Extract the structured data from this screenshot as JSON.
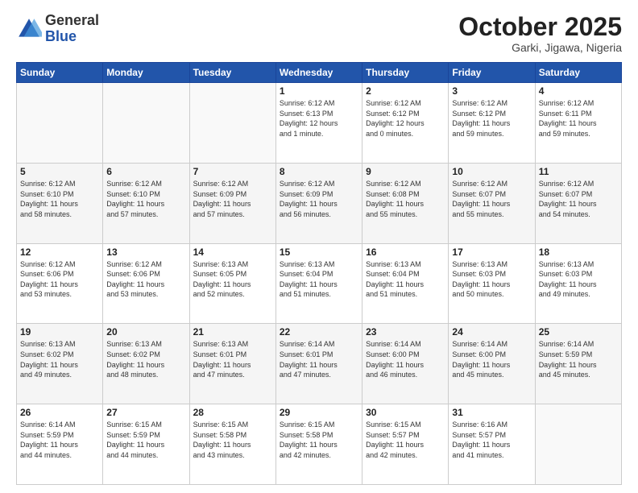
{
  "logo": {
    "general": "General",
    "blue": "Blue"
  },
  "header": {
    "month": "October 2025",
    "location": "Garki, Jigawa, Nigeria"
  },
  "weekdays": [
    "Sunday",
    "Monday",
    "Tuesday",
    "Wednesday",
    "Thursday",
    "Friday",
    "Saturday"
  ],
  "weeks": [
    [
      {
        "day": "",
        "info": ""
      },
      {
        "day": "",
        "info": ""
      },
      {
        "day": "",
        "info": ""
      },
      {
        "day": "1",
        "info": "Sunrise: 6:12 AM\nSunset: 6:13 PM\nDaylight: 12 hours\nand 1 minute."
      },
      {
        "day": "2",
        "info": "Sunrise: 6:12 AM\nSunset: 6:12 PM\nDaylight: 12 hours\nand 0 minutes."
      },
      {
        "day": "3",
        "info": "Sunrise: 6:12 AM\nSunset: 6:12 PM\nDaylight: 11 hours\nand 59 minutes."
      },
      {
        "day": "4",
        "info": "Sunrise: 6:12 AM\nSunset: 6:11 PM\nDaylight: 11 hours\nand 59 minutes."
      }
    ],
    [
      {
        "day": "5",
        "info": "Sunrise: 6:12 AM\nSunset: 6:10 PM\nDaylight: 11 hours\nand 58 minutes."
      },
      {
        "day": "6",
        "info": "Sunrise: 6:12 AM\nSunset: 6:10 PM\nDaylight: 11 hours\nand 57 minutes."
      },
      {
        "day": "7",
        "info": "Sunrise: 6:12 AM\nSunset: 6:09 PM\nDaylight: 11 hours\nand 57 minutes."
      },
      {
        "day": "8",
        "info": "Sunrise: 6:12 AM\nSunset: 6:09 PM\nDaylight: 11 hours\nand 56 minutes."
      },
      {
        "day": "9",
        "info": "Sunrise: 6:12 AM\nSunset: 6:08 PM\nDaylight: 11 hours\nand 55 minutes."
      },
      {
        "day": "10",
        "info": "Sunrise: 6:12 AM\nSunset: 6:07 PM\nDaylight: 11 hours\nand 55 minutes."
      },
      {
        "day": "11",
        "info": "Sunrise: 6:12 AM\nSunset: 6:07 PM\nDaylight: 11 hours\nand 54 minutes."
      }
    ],
    [
      {
        "day": "12",
        "info": "Sunrise: 6:12 AM\nSunset: 6:06 PM\nDaylight: 11 hours\nand 53 minutes."
      },
      {
        "day": "13",
        "info": "Sunrise: 6:12 AM\nSunset: 6:06 PM\nDaylight: 11 hours\nand 53 minutes."
      },
      {
        "day": "14",
        "info": "Sunrise: 6:13 AM\nSunset: 6:05 PM\nDaylight: 11 hours\nand 52 minutes."
      },
      {
        "day": "15",
        "info": "Sunrise: 6:13 AM\nSunset: 6:04 PM\nDaylight: 11 hours\nand 51 minutes."
      },
      {
        "day": "16",
        "info": "Sunrise: 6:13 AM\nSunset: 6:04 PM\nDaylight: 11 hours\nand 51 minutes."
      },
      {
        "day": "17",
        "info": "Sunrise: 6:13 AM\nSunset: 6:03 PM\nDaylight: 11 hours\nand 50 minutes."
      },
      {
        "day": "18",
        "info": "Sunrise: 6:13 AM\nSunset: 6:03 PM\nDaylight: 11 hours\nand 49 minutes."
      }
    ],
    [
      {
        "day": "19",
        "info": "Sunrise: 6:13 AM\nSunset: 6:02 PM\nDaylight: 11 hours\nand 49 minutes."
      },
      {
        "day": "20",
        "info": "Sunrise: 6:13 AM\nSunset: 6:02 PM\nDaylight: 11 hours\nand 48 minutes."
      },
      {
        "day": "21",
        "info": "Sunrise: 6:13 AM\nSunset: 6:01 PM\nDaylight: 11 hours\nand 47 minutes."
      },
      {
        "day": "22",
        "info": "Sunrise: 6:14 AM\nSunset: 6:01 PM\nDaylight: 11 hours\nand 47 minutes."
      },
      {
        "day": "23",
        "info": "Sunrise: 6:14 AM\nSunset: 6:00 PM\nDaylight: 11 hours\nand 46 minutes."
      },
      {
        "day": "24",
        "info": "Sunrise: 6:14 AM\nSunset: 6:00 PM\nDaylight: 11 hours\nand 45 minutes."
      },
      {
        "day": "25",
        "info": "Sunrise: 6:14 AM\nSunset: 5:59 PM\nDaylight: 11 hours\nand 45 minutes."
      }
    ],
    [
      {
        "day": "26",
        "info": "Sunrise: 6:14 AM\nSunset: 5:59 PM\nDaylight: 11 hours\nand 44 minutes."
      },
      {
        "day": "27",
        "info": "Sunrise: 6:15 AM\nSunset: 5:59 PM\nDaylight: 11 hours\nand 44 minutes."
      },
      {
        "day": "28",
        "info": "Sunrise: 6:15 AM\nSunset: 5:58 PM\nDaylight: 11 hours\nand 43 minutes."
      },
      {
        "day": "29",
        "info": "Sunrise: 6:15 AM\nSunset: 5:58 PM\nDaylight: 11 hours\nand 42 minutes."
      },
      {
        "day": "30",
        "info": "Sunrise: 6:15 AM\nSunset: 5:57 PM\nDaylight: 11 hours\nand 42 minutes."
      },
      {
        "day": "31",
        "info": "Sunrise: 6:16 AM\nSunset: 5:57 PM\nDaylight: 11 hours\nand 41 minutes."
      },
      {
        "day": "",
        "info": ""
      }
    ]
  ]
}
